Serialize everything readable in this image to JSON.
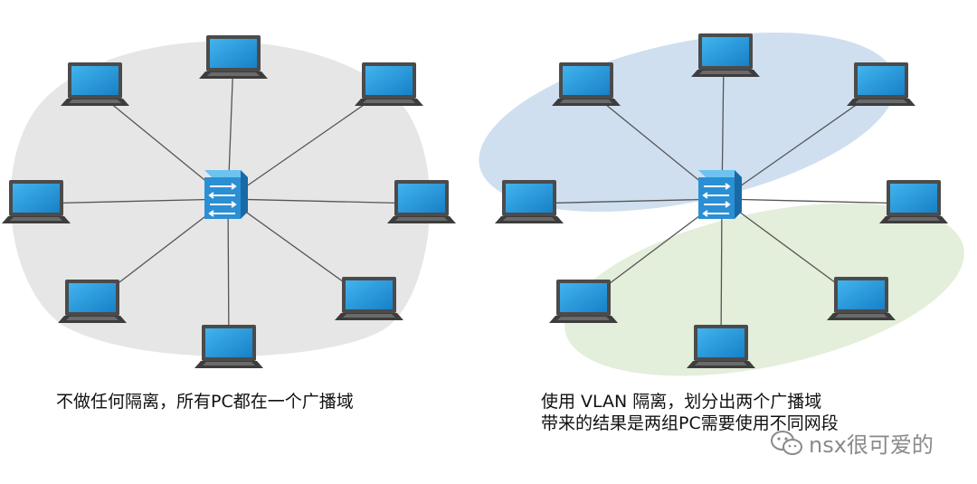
{
  "left": {
    "caption": "不做任何隔离，所有PC都在一个广播域"
  },
  "right": {
    "caption_line1": "使用 VLAN 隔离，划分出两个广播域",
    "caption_line2": "带来的结果是两组PC需要使用不同网段"
  },
  "watermark": {
    "text": "nsx很可爱的",
    "icon": "wechat-icon"
  },
  "colors": {
    "left_domain": "#e6e6e6",
    "right_domain_top": "#cfdff0",
    "right_domain_bottom": "#e3eedb",
    "switch": "#2b8fd4",
    "screen": "#1d93d8",
    "laptop_body": "#4a4a4a",
    "link": "#555555"
  }
}
